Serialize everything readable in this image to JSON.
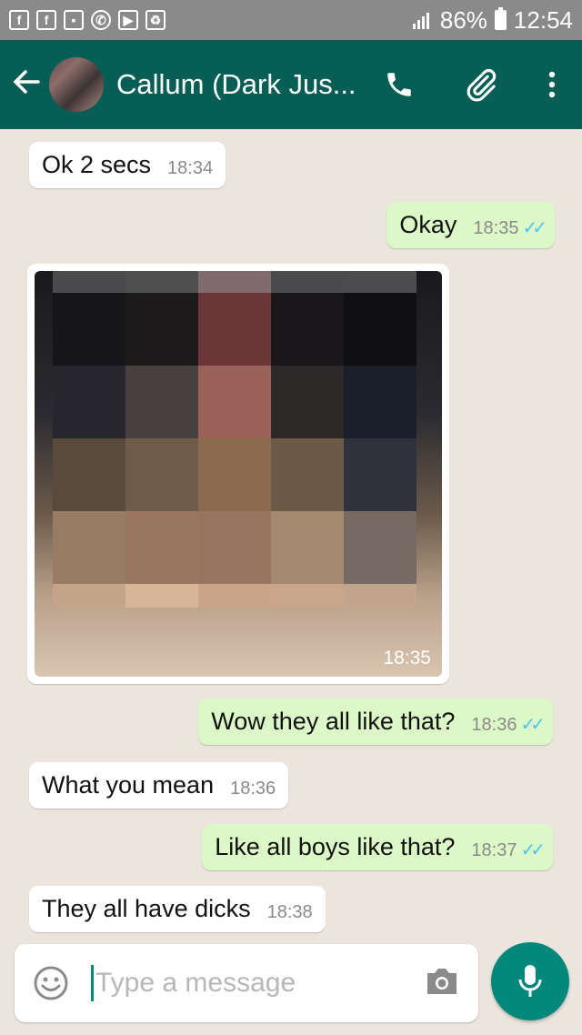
{
  "status_bar": {
    "battery": "86%",
    "time": "12:54",
    "notification_icons": [
      "facebook-icon",
      "facebook-icon",
      "gallery-icon",
      "whatsapp-icon",
      "youtube-icon",
      "recycle-icon"
    ]
  },
  "header": {
    "contact_name": "Callum (Dark Jus...",
    "icons": [
      "back-arrow-icon",
      "avatar",
      "phone-icon",
      "paperclip-icon",
      "more-vert-icon"
    ]
  },
  "messages": [
    {
      "dir": "in",
      "text": "Ok 2 secs",
      "time": "18:34"
    },
    {
      "dir": "out",
      "text": "Okay",
      "time": "18:35",
      "ticks": "✓✓"
    },
    {
      "dir": "in",
      "type": "image",
      "time": "18:35"
    },
    {
      "dir": "out",
      "text": "Wow they all like that?",
      "time": "18:36",
      "ticks": "✓✓"
    },
    {
      "dir": "in",
      "text": "What you mean",
      "time": "18:36"
    },
    {
      "dir": "out",
      "text": "Like all boys like that?",
      "time": "18:37",
      "ticks": "✓✓"
    },
    {
      "dir": "in",
      "text": "They all have dicks",
      "time": "18:38"
    }
  ],
  "input": {
    "placeholder": "Type a message"
  },
  "colors": {
    "header": "#075e54",
    "accent": "#00897b",
    "outgoing_bubble": "#dcf8c6",
    "incoming_bubble": "#ffffff",
    "read_ticks": "#4fc3f7",
    "chat_background": "#ece5dd"
  }
}
